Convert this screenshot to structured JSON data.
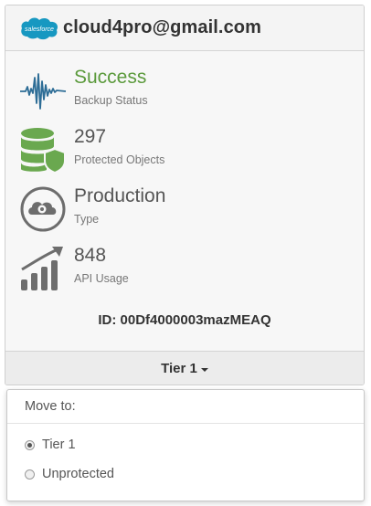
{
  "header": {
    "logo_text": "salesforce",
    "account": "cloud4pro@gmail.com"
  },
  "stats": [
    {
      "value": "Success",
      "label": "Backup Status",
      "icon": "pulse-icon"
    },
    {
      "value": "297",
      "label": "Protected Objects",
      "icon": "database-shield-icon"
    },
    {
      "value": "Production",
      "label": "Type",
      "icon": "cloud-gear-icon"
    },
    {
      "value": "848",
      "label": "API Usage",
      "icon": "bar-chart-trend-icon"
    }
  ],
  "org_id": "ID: 00Df4000003mazMEAQ",
  "footer": {
    "tier": "Tier 1"
  },
  "menu": {
    "title": "Move to:",
    "options": [
      {
        "label": "Tier 1",
        "selected": true
      },
      {
        "label": "Unprotected",
        "selected": false
      }
    ]
  },
  "colors": {
    "success": "#5b9a3c",
    "salesforce_blue": "#1798c1",
    "database_green": "#6aa84f",
    "icon_gray": "#6d6d6d"
  }
}
